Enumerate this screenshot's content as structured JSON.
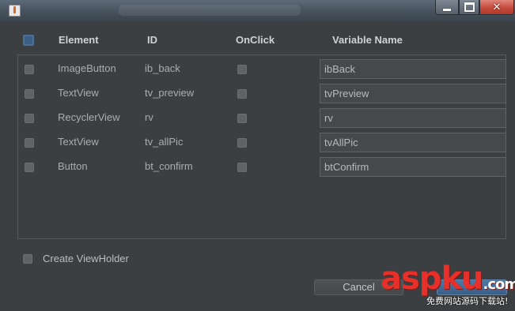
{
  "window": {
    "title": ""
  },
  "table": {
    "headers": {
      "element": "Element",
      "id": "ID",
      "onclick": "OnClick",
      "variable": "Variable Name"
    },
    "rows": [
      {
        "element": "ImageButton",
        "id": "ib_back",
        "variable": "ibBack"
      },
      {
        "element": "TextView",
        "id": "tv_preview",
        "variable": "tvPreview"
      },
      {
        "element": "RecyclerView",
        "id": "rv",
        "variable": "rv"
      },
      {
        "element": "TextView",
        "id": "tv_allPic",
        "variable": "tvAllPic"
      },
      {
        "element": "Button",
        "id": "bt_confirm",
        "variable": "btConfirm"
      }
    ]
  },
  "options": {
    "create_viewholder_label": "Create ViewHolder"
  },
  "buttons": {
    "cancel_label": "Cancel",
    "confirm_label": ""
  },
  "watermark": {
    "brand_a": "asp",
    "brand_b": "ku",
    "brand_c": ".com",
    "tagline": "免费网站源码下载站!"
  },
  "colors": {
    "background": "#3c3f41",
    "accent": "#3c5f86",
    "watermark": "#e8302a"
  }
}
